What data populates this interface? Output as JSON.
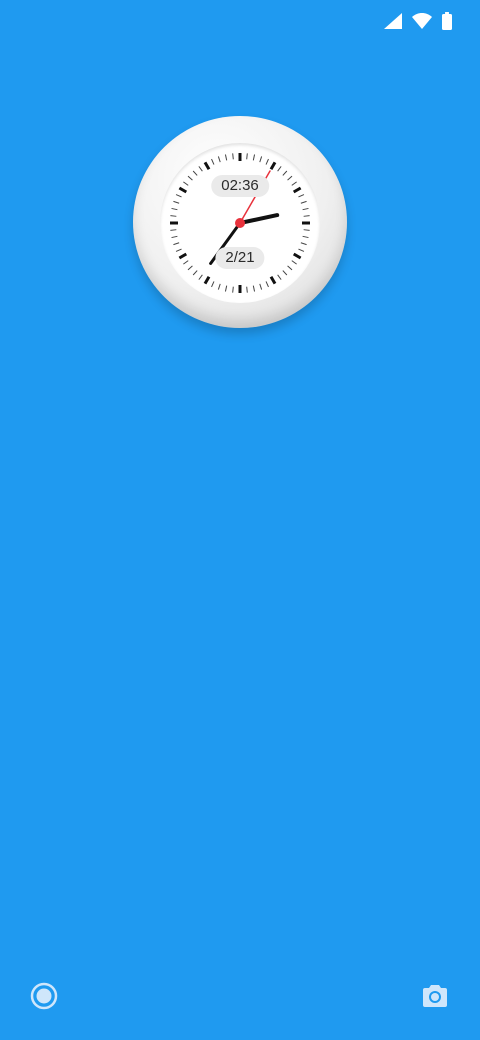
{
  "status_bar": {
    "icons": [
      "cellular-signal-icon",
      "wifi-icon",
      "battery-icon"
    ]
  },
  "clock_widget": {
    "time": "02:36",
    "date": "2/21",
    "hour_hand_color": "#111111",
    "second_hand_color": "#e8323c"
  },
  "bottom_shortcuts": {
    "left_icon": "assistant-circle-icon",
    "right_icon": "camera-icon"
  },
  "colors": {
    "wallpaper": "#1f9af0",
    "icon_light": "#cfe6fb"
  }
}
